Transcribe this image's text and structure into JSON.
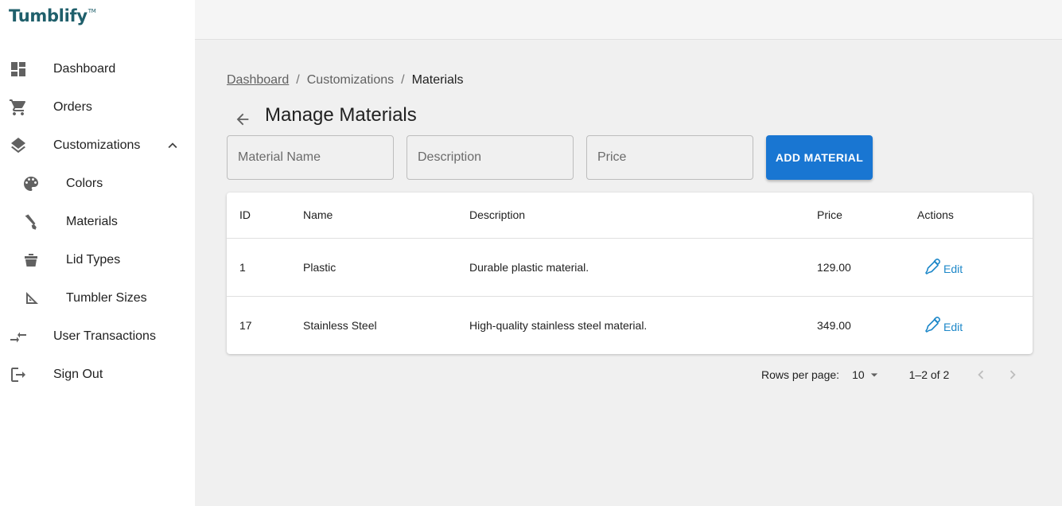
{
  "app": {
    "brand": "Tumblify",
    "brand_mark": "TM"
  },
  "sidebar": {
    "items": [
      {
        "label": "Dashboard",
        "icon": "dashboard-icon"
      },
      {
        "label": "Orders",
        "icon": "cart-icon"
      },
      {
        "label": "Customizations",
        "icon": "layers-icon",
        "expanded": true
      },
      {
        "label": "Colors",
        "icon": "palette-icon"
      },
      {
        "label": "Materials",
        "icon": "material-icon"
      },
      {
        "label": "Lid Types",
        "icon": "lid-icon"
      },
      {
        "label": "Tumbler Sizes",
        "icon": "ruler-triangle-icon"
      },
      {
        "label": "User Transactions",
        "icon": "transfer-icon"
      },
      {
        "label": "Sign Out",
        "icon": "logout-icon"
      }
    ]
  },
  "breadcrumb": {
    "items": [
      "Dashboard",
      "Customizations",
      "Materials"
    ],
    "separator": "/"
  },
  "page": {
    "title": "Manage Materials"
  },
  "form": {
    "name_placeholder": "Material Name",
    "description_placeholder": "Description",
    "price_placeholder": "Price",
    "add_label": "ADD MATERIAL"
  },
  "table": {
    "headers": {
      "id": "ID",
      "name": "Name",
      "description": "Description",
      "price": "Price",
      "actions": "Actions"
    },
    "rows": [
      {
        "id": "1",
        "name": "Plastic",
        "description": "Durable plastic material.",
        "price": "129.00",
        "action": "Edit"
      },
      {
        "id": "17",
        "name": "Stainless Steel",
        "description": "High-quality stainless steel material.",
        "price": "349.00",
        "action": "Edit"
      }
    ]
  },
  "pagination": {
    "rows_per_page_label": "Rows per page:",
    "rows_per_page": "10",
    "range": "1–2 of 2"
  },
  "colors": {
    "primary": "#1976d2",
    "brand": "#1f5f6b",
    "link": "#1e88c9"
  }
}
